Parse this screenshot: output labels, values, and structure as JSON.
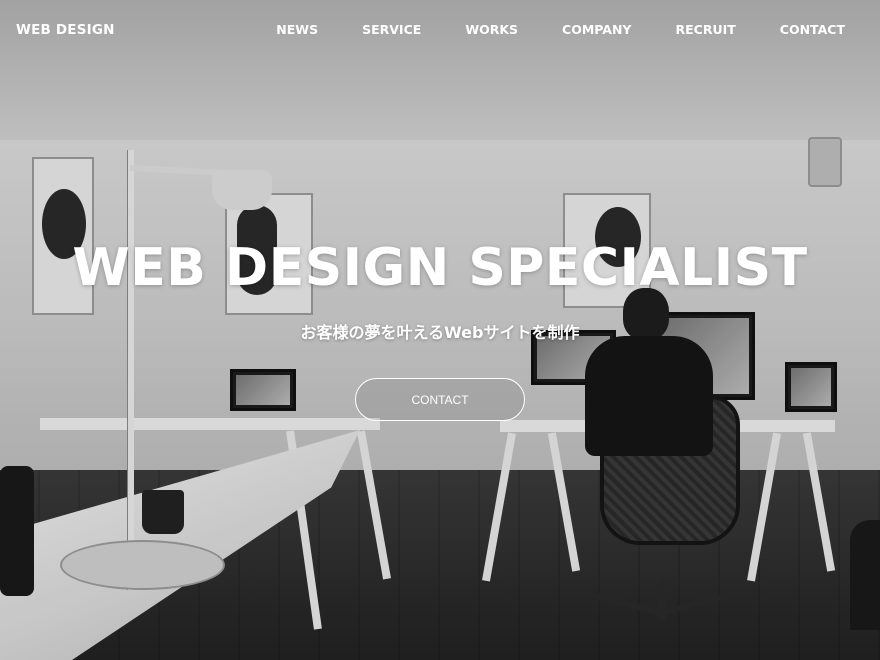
{
  "header": {
    "logo": "WEB DESIGN",
    "nav": [
      "NEWS",
      "SERVICE",
      "WORKS",
      "COMPANY",
      "RECRUIT",
      "CONTACT"
    ]
  },
  "hero": {
    "title": "WEB DESIGN SPECIALIST",
    "subtitle": "お客様の夢を叶えるWebサイトを制作",
    "cta_label": "CONTACT",
    "background_image": "grayscale-office-photo"
  },
  "colors": {
    "text": "#ffffff",
    "cta_border": "#ffffff"
  }
}
